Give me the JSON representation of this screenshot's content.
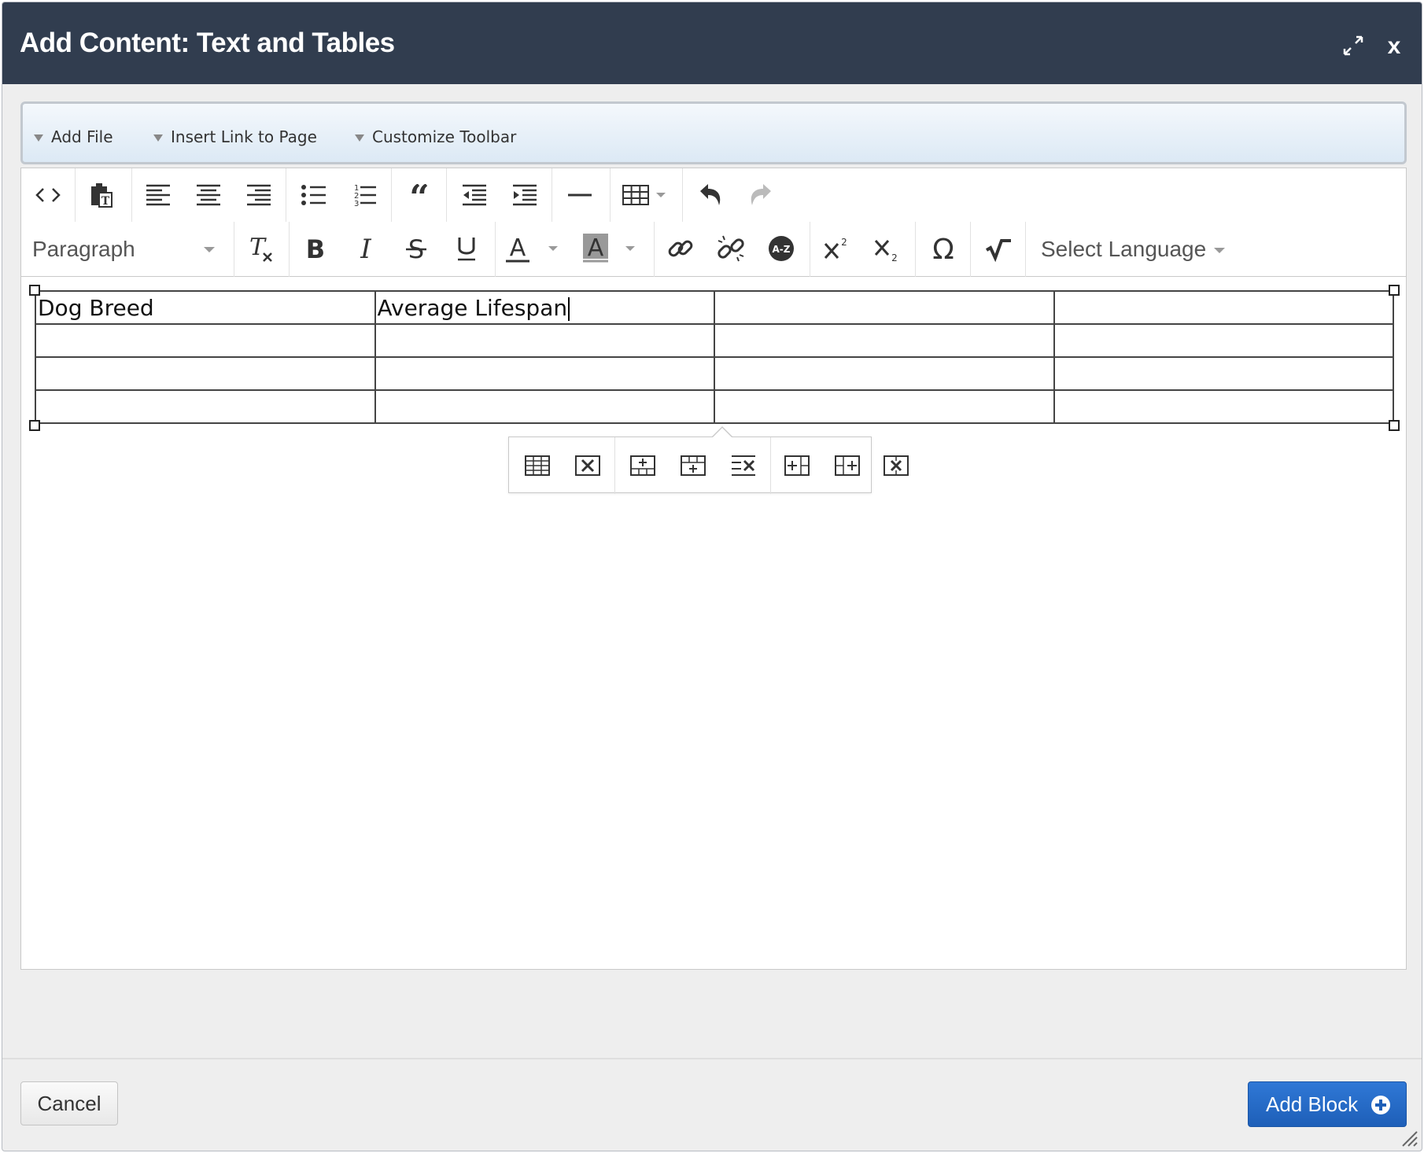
{
  "dialog": {
    "title": "Add Content: Text and Tables",
    "close_label": "x",
    "expand_icon": "expand-icon"
  },
  "plugin_bar": {
    "items": [
      {
        "label": "Add File"
      },
      {
        "label": "Insert Link to Page"
      },
      {
        "label": "Customize Toolbar"
      }
    ]
  },
  "toolbar": {
    "row1_icons": [
      "source-code-icon",
      "paste-as-text-icon",
      "align-left-icon",
      "align-center-icon",
      "align-right-icon",
      "bullet-list-icon",
      "numbered-list-icon",
      "blockquote-icon",
      "outdent-icon",
      "indent-icon",
      "horizontal-rule-icon",
      "table-icon",
      "undo-icon",
      "redo-icon"
    ],
    "paragraph_format": "Paragraph",
    "row2_icons": [
      "clear-formatting-icon",
      "bold-icon",
      "italic-icon",
      "strikethrough-icon",
      "underline-icon",
      "text-color-icon",
      "background-color-icon",
      "link-icon",
      "unlink-icon",
      "glossary-icon",
      "superscript-icon",
      "subscript-icon",
      "special-character-icon",
      "math-equation-icon"
    ],
    "language_select": "Select Language"
  },
  "table": {
    "rows": [
      [
        "Dog Breed",
        "Average Lifespan",
        "",
        ""
      ],
      [
        "",
        "",
        "",
        ""
      ],
      [
        "",
        "",
        "",
        ""
      ],
      [
        "",
        "",
        "",
        ""
      ]
    ]
  },
  "table_popup": {
    "icons": [
      "table-properties-icon",
      "delete-table-icon",
      "insert-row-before-icon",
      "insert-row-after-icon",
      "delete-row-icon",
      "insert-column-before-icon",
      "insert-column-after-icon",
      "delete-column-icon"
    ]
  },
  "footer": {
    "cancel_label": "Cancel",
    "add_block_label": "Add Block"
  },
  "colors": {
    "titlebar": "#313d4f",
    "primary_button": "#1e5fb8",
    "dialog_background": "#eeeeee"
  }
}
